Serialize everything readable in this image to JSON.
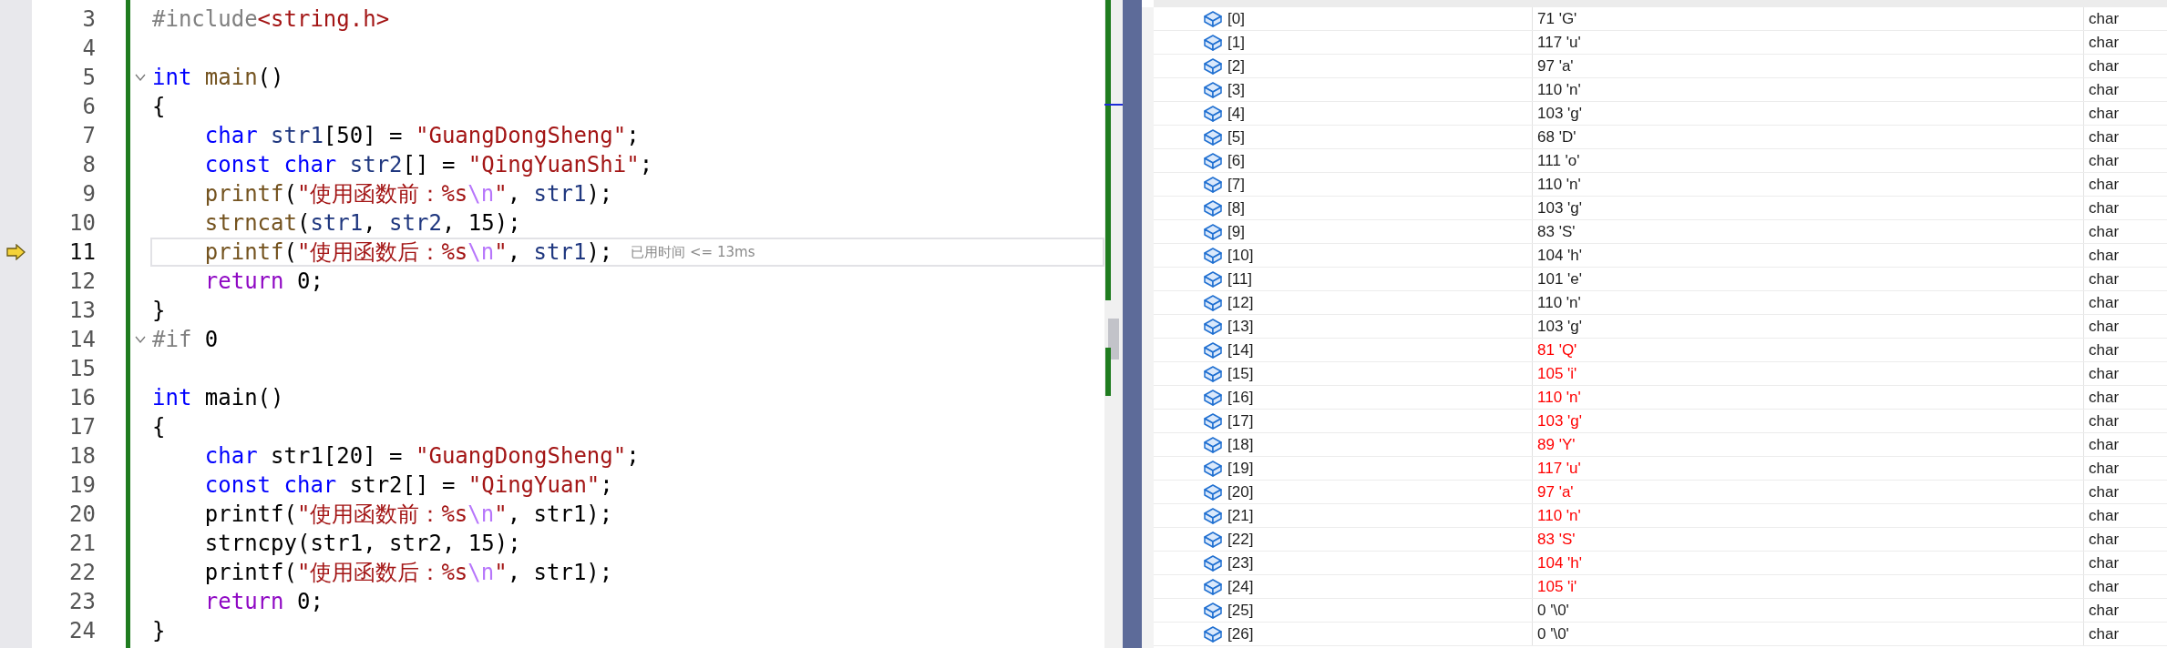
{
  "editor": {
    "lines": [
      {
        "number": "3",
        "current": false,
        "foldable": false,
        "tokens": [
          {
            "kind": "preproc",
            "text": "#include"
          },
          {
            "kind": "path",
            "text": "<string.h>"
          }
        ]
      },
      {
        "number": "4",
        "current": false,
        "foldable": false
      },
      {
        "number": "5",
        "current": false,
        "foldable": true,
        "tokens": [
          {
            "kind": "keyword",
            "text": "int"
          },
          {
            "kind": "function",
            "text": " main"
          },
          {
            "kind": "plain",
            "text": "()"
          }
        ]
      },
      {
        "number": "6",
        "current": false,
        "foldable": false,
        "tokens": [
          {
            "kind": "plain",
            "text": "{"
          }
        ]
      },
      {
        "number": "7",
        "current": false,
        "foldable": false,
        "tokens": [
          {
            "kind": "keyword",
            "text": "    char"
          },
          {
            "kind": "variable",
            "text": " str1"
          },
          {
            "kind": "plain",
            "text": "[50] = "
          },
          {
            "kind": "string",
            "text": "\"GuangDongSheng\""
          },
          {
            "kind": "plain",
            "text": ";"
          }
        ]
      },
      {
        "number": "8",
        "current": false,
        "foldable": false,
        "tokens": [
          {
            "kind": "keyword",
            "text": "    const char"
          },
          {
            "kind": "variable",
            "text": " str2"
          },
          {
            "kind": "plain",
            "text": "[] = "
          },
          {
            "kind": "string",
            "text": "\"QingYuanShi\""
          },
          {
            "kind": "plain",
            "text": ";"
          }
        ]
      },
      {
        "number": "9",
        "current": false,
        "foldable": false,
        "tokens": [
          {
            "kind": "function",
            "text": "    printf"
          },
          {
            "kind": "plain",
            "text": "("
          },
          {
            "kind": "string",
            "text": "\"使用函数前：%s"
          },
          {
            "kind": "escape",
            "text": "\\n"
          },
          {
            "kind": "string",
            "text": "\""
          },
          {
            "kind": "plain",
            "text": ", "
          },
          {
            "kind": "variable",
            "text": "str1"
          },
          {
            "kind": "plain",
            "text": ");"
          }
        ]
      },
      {
        "number": "10",
        "current": false,
        "foldable": false,
        "tokens": [
          {
            "kind": "function",
            "text": "    strncat"
          },
          {
            "kind": "plain",
            "text": "("
          },
          {
            "kind": "variable",
            "text": "str1"
          },
          {
            "kind": "plain",
            "text": ", "
          },
          {
            "kind": "variable",
            "text": "str2"
          },
          {
            "kind": "plain",
            "text": ", 15);"
          }
        ]
      },
      {
        "number": "11",
        "current": true,
        "foldable": false,
        "hint": "已用时间 <= 13ms",
        "tokens": [
          {
            "kind": "function",
            "text": "    printf"
          },
          {
            "kind": "plain",
            "text": "("
          },
          {
            "kind": "string",
            "text": "\"使用函数后：%s"
          },
          {
            "kind": "escape",
            "text": "\\n"
          },
          {
            "kind": "string",
            "text": "\""
          },
          {
            "kind": "plain",
            "text": ", "
          },
          {
            "kind": "variable",
            "text": "str1"
          },
          {
            "kind": "plain",
            "text": ");"
          }
        ]
      },
      {
        "number": "12",
        "current": false,
        "foldable": false,
        "tokens": [
          {
            "kind": "control",
            "text": "    return"
          },
          {
            "kind": "plain",
            "text": " 0;"
          }
        ]
      },
      {
        "number": "13",
        "current": false,
        "foldable": false,
        "tokens": [
          {
            "kind": "plain",
            "text": "}"
          }
        ]
      },
      {
        "number": "14",
        "current": false,
        "foldable": true,
        "tokens": [
          {
            "kind": "preproc",
            "text": "#if"
          },
          {
            "kind": "plain",
            "text": " 0"
          }
        ]
      },
      {
        "number": "15",
        "current": false,
        "foldable": false
      },
      {
        "number": "16",
        "current": false,
        "foldable": false,
        "tokens": [
          {
            "kind": "keyword",
            "text": "int"
          },
          {
            "kind": "plain",
            "text": " main()"
          }
        ]
      },
      {
        "number": "17",
        "current": false,
        "foldable": false,
        "tokens": [
          {
            "kind": "plain",
            "text": "{"
          }
        ]
      },
      {
        "number": "18",
        "current": false,
        "foldable": false,
        "tokens": [
          {
            "kind": "keyword",
            "text": "    char"
          },
          {
            "kind": "plain",
            "text": " str1[20] = "
          },
          {
            "kind": "string",
            "text": "\"GuangDongSheng\""
          },
          {
            "kind": "plain",
            "text": ";"
          }
        ]
      },
      {
        "number": "19",
        "current": false,
        "foldable": false,
        "tokens": [
          {
            "kind": "keyword",
            "text": "    const char"
          },
          {
            "kind": "plain",
            "text": " str2[] = "
          },
          {
            "kind": "string",
            "text": "\"QingYuan\""
          },
          {
            "kind": "plain",
            "text": ";"
          }
        ]
      },
      {
        "number": "20",
        "current": false,
        "foldable": false,
        "tokens": [
          {
            "kind": "plain",
            "text": "    printf("
          },
          {
            "kind": "string",
            "text": "\"使用函数前：%s"
          },
          {
            "kind": "escape",
            "text": "\\n"
          },
          {
            "kind": "string",
            "text": "\""
          },
          {
            "kind": "plain",
            "text": ", str1);"
          }
        ]
      },
      {
        "number": "21",
        "current": false,
        "foldable": false,
        "tokens": [
          {
            "kind": "plain",
            "text": "    strncpy(str1, str2, 15);"
          }
        ]
      },
      {
        "number": "22",
        "current": false,
        "foldable": false,
        "tokens": [
          {
            "kind": "plain",
            "text": "    printf("
          },
          {
            "kind": "string",
            "text": "\"使用函数后：%s"
          },
          {
            "kind": "escape",
            "text": "\\n"
          },
          {
            "kind": "string",
            "text": "\""
          },
          {
            "kind": "plain",
            "text": ", str1);"
          }
        ]
      },
      {
        "number": "23",
        "current": false,
        "foldable": false,
        "tokens": [
          {
            "kind": "control",
            "text": "    return"
          },
          {
            "kind": "plain",
            "text": " 0;"
          }
        ]
      },
      {
        "number": "24",
        "current": false,
        "foldable": false,
        "tokens": [
          {
            "kind": "plain",
            "text": "}"
          }
        ]
      }
    ]
  },
  "watch": {
    "rows": [
      {
        "name": "[0]",
        "value": "71 'G'",
        "type": "char",
        "changed": false
      },
      {
        "name": "[1]",
        "value": "117 'u'",
        "type": "char",
        "changed": false
      },
      {
        "name": "[2]",
        "value": "97 'a'",
        "type": "char",
        "changed": false
      },
      {
        "name": "[3]",
        "value": "110 'n'",
        "type": "char",
        "changed": false
      },
      {
        "name": "[4]",
        "value": "103 'g'",
        "type": "char",
        "changed": false
      },
      {
        "name": "[5]",
        "value": "68 'D'",
        "type": "char",
        "changed": false
      },
      {
        "name": "[6]",
        "value": "111 'o'",
        "type": "char",
        "changed": false
      },
      {
        "name": "[7]",
        "value": "110 'n'",
        "type": "char",
        "changed": false
      },
      {
        "name": "[8]",
        "value": "103 'g'",
        "type": "char",
        "changed": false
      },
      {
        "name": "[9]",
        "value": "83 'S'",
        "type": "char",
        "changed": false
      },
      {
        "name": "[10]",
        "value": "104 'h'",
        "type": "char",
        "changed": false
      },
      {
        "name": "[11]",
        "value": "101 'e'",
        "type": "char",
        "changed": false
      },
      {
        "name": "[12]",
        "value": "110 'n'",
        "type": "char",
        "changed": false
      },
      {
        "name": "[13]",
        "value": "103 'g'",
        "type": "char",
        "changed": false
      },
      {
        "name": "[14]",
        "value": "81 'Q'",
        "type": "char",
        "changed": true
      },
      {
        "name": "[15]",
        "value": "105 'i'",
        "type": "char",
        "changed": true
      },
      {
        "name": "[16]",
        "value": "110 'n'",
        "type": "char",
        "changed": true
      },
      {
        "name": "[17]",
        "value": "103 'g'",
        "type": "char",
        "changed": true
      },
      {
        "name": "[18]",
        "value": "89 'Y'",
        "type": "char",
        "changed": true
      },
      {
        "name": "[19]",
        "value": "117 'u'",
        "type": "char",
        "changed": true
      },
      {
        "name": "[20]",
        "value": "97 'a'",
        "type": "char",
        "changed": true
      },
      {
        "name": "[21]",
        "value": "110 'n'",
        "type": "char",
        "changed": true
      },
      {
        "name": "[22]",
        "value": "83 'S'",
        "type": "char",
        "changed": true
      },
      {
        "name": "[23]",
        "value": "104 'h'",
        "type": "char",
        "changed": true
      },
      {
        "name": "[24]",
        "value": "105 'i'",
        "type": "char",
        "changed": true
      },
      {
        "name": "[25]",
        "value": "0 '\\0'",
        "type": "char",
        "changed": false
      },
      {
        "name": "[26]",
        "value": "0 '\\0'",
        "type": "char",
        "changed": false
      }
    ]
  }
}
